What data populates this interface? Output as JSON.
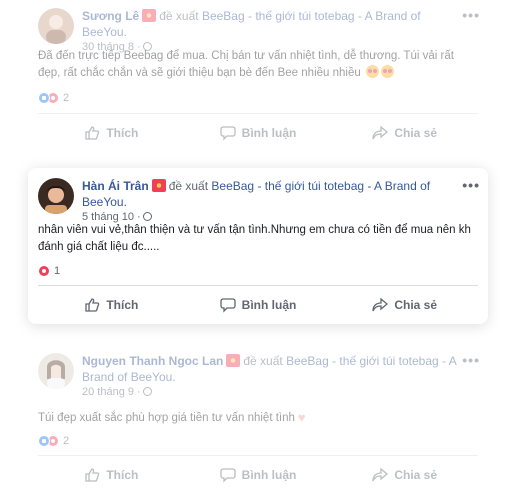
{
  "posts": [
    {
      "author": "Sương Lê",
      "verb": "đề xuất",
      "page": "BeeBag - thế giới túi totebag - A Brand of BeeYou.",
      "time": "30 tháng 8 ·",
      "text": "Đã đến trực tiếp Beebag để mua. Chị bán tư vấn nhiệt tình, dễ thương. Túi vải rất đẹp, rất chắc chắn và sẽ giới thiệu bạn bè đến Bee nhiều nhiều",
      "reaction_count": "2"
    },
    {
      "author": "Hàn Ái Trân",
      "verb": "đề xuất",
      "page": "BeeBag - thế giới túi totebag - A Brand of BeeYou.",
      "time": "5 tháng 10 ·",
      "text": "nhân viên vui vẻ,thân thiện và tư vấn tận tình.Nhưng em chưa có tiền để mua nên kh đánh giá chất liệu đc.....",
      "reaction_count": "1"
    },
    {
      "author": "Nguyen Thanh Ngoc Lan",
      "verb": "đề xuất",
      "page": "BeeBag - thế giới túi totebag - A Brand of BeeYou.",
      "time": "20 tháng 9 ·",
      "text": "Túi đẹp xuất sắc phù hợp giá tiền tư vấn nhiệt tình",
      "reaction_count": "2"
    }
  ],
  "actions": {
    "like": "Thích",
    "comment": "Bình luận",
    "share": "Chia sẻ"
  },
  "more_label": "•••",
  "icons": [
    "recommend-flag-icon",
    "globe-icon",
    "like-reaction-icon",
    "love-reaction-icon",
    "thumbs-up-icon",
    "comment-icon",
    "share-icon",
    "more-options-icon"
  ],
  "colors": {
    "link": "#385898",
    "secondary_text": "#606770",
    "like_blue": "#1877f2",
    "love_red": "#f33e58"
  }
}
